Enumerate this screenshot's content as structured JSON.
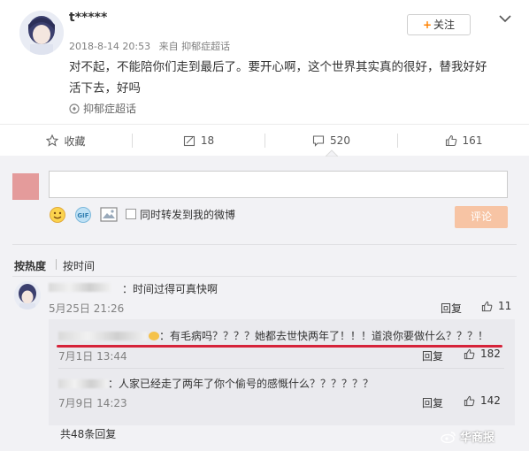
{
  "post": {
    "username": "t*****",
    "date": "2018-8-14 20:53",
    "source_prefix": "来自",
    "source": "抑郁症超话",
    "content": "对不起，不能陪你们走到最后了。要开心啊，这个世界其实真的很好，替我好好活下去，好吗",
    "topic": "抑郁症超话",
    "follow_label": "关注"
  },
  "actions": {
    "favorite_label": "收藏",
    "repost_count": "18",
    "comment_count": "520",
    "like_count": "161"
  },
  "composer": {
    "forward_label": "同时转发到我的微博",
    "submit_label": "评论"
  },
  "sort": {
    "by_hot": "按热度",
    "by_time": "按时间"
  },
  "comment": {
    "text": "：时间过得可真快啊",
    "time": "5月25日 21:26",
    "reply_label": "回复",
    "likes": "11"
  },
  "replies": [
    {
      "text": "：有毛病吗？？？？她都去世快两年了！！！道浪你要做什么？？？！",
      "time": "7月1日 13:44",
      "reply_label": "回复",
      "likes": "182"
    },
    {
      "text": "：人家已经走了两年了你个偷号的感慨什么？？？？？？",
      "time": "7月9日 14:23",
      "reply_label": "回复",
      "likes": "142"
    }
  ],
  "total_replies": "共48条回复",
  "watermark": "华商报",
  "icons": [
    "star-icon",
    "repost-icon",
    "comment-icon",
    "thumb-up-icon",
    "emoji-icon",
    "gif-icon",
    "image-icon",
    "chevron-down-icon",
    "super-topic-icon",
    "weibo-icon"
  ],
  "colors": {
    "follow_plus": "#ff8200",
    "submit_bg": "#f7c4a4",
    "highlight_line": "#d6233a",
    "page_bg": "#f2f2f5"
  }
}
